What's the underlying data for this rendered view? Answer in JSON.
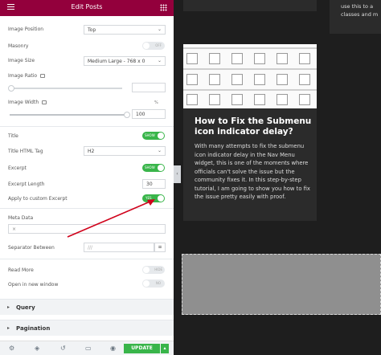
{
  "panel": {
    "title": "Edit Posts",
    "fields": {
      "image_position": {
        "label": "Image Position",
        "value": "Top"
      },
      "masonry": {
        "label": "Masonry",
        "toggle": "OFF"
      },
      "image_size": {
        "label": "Image Size",
        "value": "Medium Large - 768 x 0"
      },
      "image_ratio": {
        "label": "Image Ratio"
      },
      "image_width": {
        "label": "Image Width",
        "unit": "%",
        "value": "100"
      },
      "title": {
        "label": "Title",
        "toggle": "SHOW"
      },
      "title_tag": {
        "label": "Title HTML Tag",
        "value": "H2"
      },
      "excerpt": {
        "label": "Excerpt",
        "toggle": "SHOW"
      },
      "excerpt_length": {
        "label": "Excerpt Length",
        "value": "30"
      },
      "apply_custom_excerpt": {
        "label": "Apply to custom Excerpt",
        "toggle": "YES"
      },
      "meta_data": {
        "label": "Meta Data"
      },
      "separator": {
        "label": "Separator Between",
        "value": "///"
      },
      "read_more": {
        "label": "Read More",
        "toggle": "HIDE"
      },
      "open_new_window": {
        "label": "Open in new window",
        "toggle": "NO"
      }
    },
    "sections": {
      "query": "Query",
      "pagination": "Pagination"
    },
    "footer": {
      "update": "UPDATE"
    }
  },
  "preview": {
    "top_right_text": [
      "use this to a",
      "classes and m"
    ],
    "post": {
      "title": "How to Fix the Submenu icon indicator delay?",
      "excerpt": "With many attempts to fix the submenu icon indicator delay in the Nav Menu widget, this is one of the moments where officials can't solve the issue but the community fixes it. In this step-by-step tutorial, I am going to show you how to fix the issue pretty easily with proof."
    }
  },
  "colors": {
    "header": "#93003c",
    "toggle_on": "#39b54a",
    "arrow": "#d0021b"
  }
}
